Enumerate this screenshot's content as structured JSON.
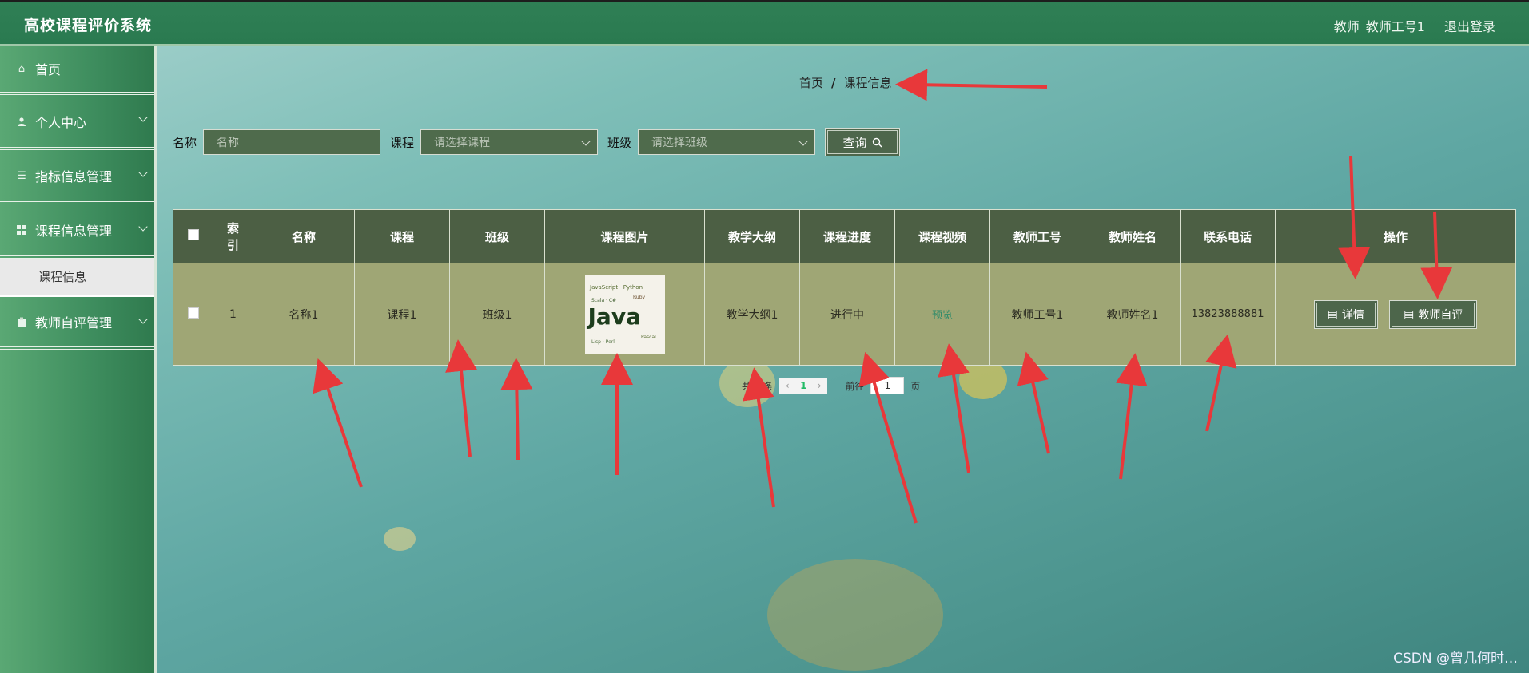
{
  "header": {
    "app_title": "高校课程评价系统",
    "role": "教师",
    "user": "教师工号1",
    "logout": "退出登录"
  },
  "sidebar": {
    "items": [
      {
        "label": "首页",
        "icon": "home-icon"
      },
      {
        "label": "个人中心",
        "icon": "user-icon"
      },
      {
        "label": "指标信息管理",
        "icon": "list-icon"
      },
      {
        "label": "课程信息管理",
        "icon": "grid-icon"
      },
      {
        "label": "教师自评管理",
        "icon": "clipboard-icon"
      }
    ],
    "sub_item": "课程信息"
  },
  "breadcrumb": {
    "home": "首页",
    "sep": "/",
    "current": "课程信息"
  },
  "search": {
    "name_label": "名称",
    "name_placeholder": "名称",
    "course_label": "课程",
    "course_placeholder": "请选择课程",
    "class_label": "班级",
    "class_placeholder": "请选择班级",
    "query_button": "查询"
  },
  "table": {
    "headers": [
      "索引",
      "名称",
      "课程",
      "班级",
      "课程图片",
      "教学大纲",
      "课程进度",
      "课程视频",
      "教师工号",
      "教师姓名",
      "联系电话",
      "操作"
    ],
    "index_header_line1": "索",
    "index_header_line2": "引",
    "rows": [
      {
        "index": "1",
        "name": "名称1",
        "course": "课程1",
        "class": "班级1",
        "image_text": "Java",
        "syllabus": "教学大纲1",
        "progress": "进行中",
        "video": "预览",
        "teacher_id": "教师工号1",
        "teacher_name": "教师姓名1",
        "phone": "13823888881",
        "btn_detail": "详情",
        "btn_review": "教师自评"
      }
    ]
  },
  "pager": {
    "total_prefix": "共",
    "total": "1",
    "total_suffix": "条",
    "current_page": "1",
    "goto_label": "前往",
    "goto_value": "1",
    "page_suffix": "页"
  },
  "watermark": "CSDN @曾几何时…",
  "colors": {
    "topbar": "#2f7f55",
    "table_header": "#4c5f44",
    "table_row": "#9fa675",
    "annotation_arrow": "#e8383a"
  }
}
